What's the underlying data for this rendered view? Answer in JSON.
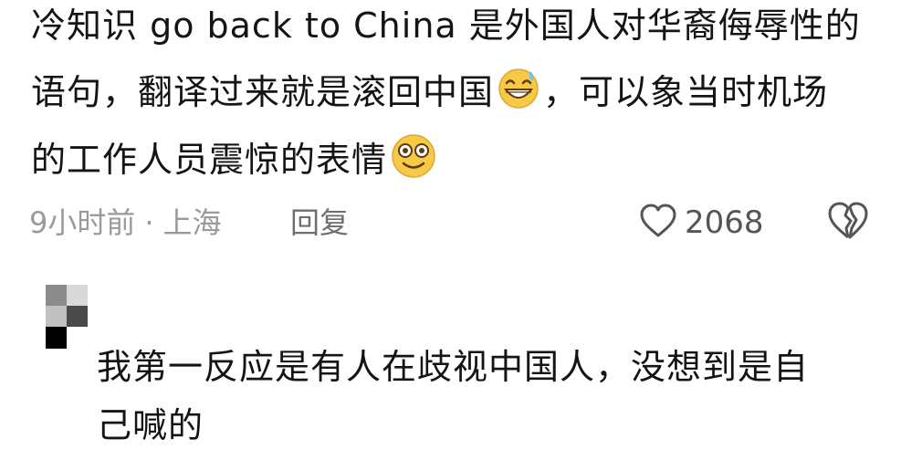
{
  "comment": {
    "line1": "冷知识 go back to China 是外国人对华裔侮辱性的",
    "line2_a": "语句，翻译过来就是滚回中国",
    "line2_b": "，可以象当时机场",
    "line3": "的工作人员震惊的表情",
    "time": "9小时前",
    "separator": "·",
    "location": "上海",
    "reply_label": "回复",
    "like_count": "2068",
    "emoji_1": "grinning-sweat-emoji",
    "emoji_2": "smiling-eyes-emoji",
    "like_icon": "heart-outline-icon",
    "dislike_icon": "broken-heart-icon"
  },
  "reply": {
    "avatar": "pixelated-avatar",
    "line1": "我第一反应是有人在歧视中国人，没想到是自",
    "line2": "己喊的"
  },
  "colors": {
    "text": "#141414",
    "meta": "#9a9a9a",
    "emoji_yellow": "#f7c948"
  }
}
